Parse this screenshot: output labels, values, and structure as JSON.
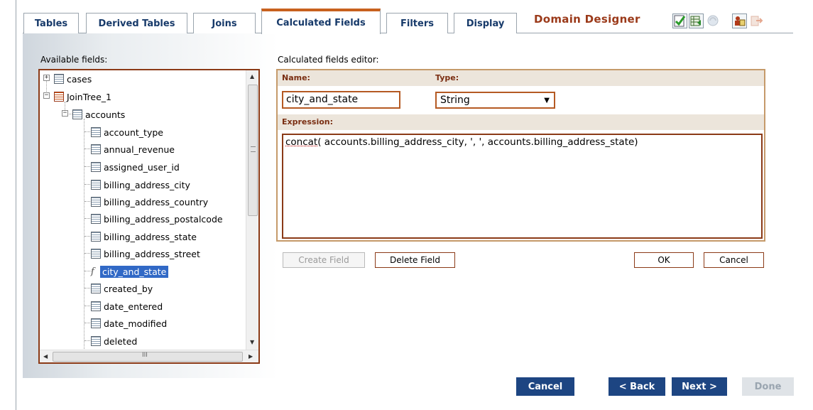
{
  "tabs": [
    {
      "label": "Tables"
    },
    {
      "label": "Derived Tables"
    },
    {
      "label": "Joins"
    },
    {
      "label": "Calculated Fields",
      "active": true
    },
    {
      "label": "Filters"
    },
    {
      "label": "Display"
    }
  ],
  "header": {
    "title": "Domain Designer",
    "toolbar_icons": [
      "check-document-icon",
      "table-export-icon",
      "refresh-globe-icon",
      "users-edit-icon",
      "exit-arrow-icon"
    ]
  },
  "available": {
    "label": "Available fields:",
    "tree": {
      "cases": "cases",
      "jointree": "JoinTree_1",
      "accounts": "accounts",
      "fields": [
        "account_type",
        "annual_revenue",
        "assigned_user_id",
        "billing_address_city",
        "billing_address_country",
        "billing_address_postalcode",
        "billing_address_state",
        "billing_address_street",
        "city_and_state",
        "created_by",
        "date_entered",
        "date_modified",
        "deleted"
      ],
      "selected": "city_and_state",
      "hscroll_mark": "III"
    }
  },
  "editor": {
    "label": "Calculated fields editor:",
    "name_label": "Name:",
    "type_label": "Type:",
    "name_value": "city_and_state",
    "type_value": "String",
    "expression_label": "Expression:",
    "expression_fn": "concat",
    "expression_rest": "( accounts.billing_address_city, ', ', accounts.billing_address_state)"
  },
  "buttons": {
    "create": "Create Field",
    "delete": "Delete Field",
    "ok": "OK",
    "cancel": "Cancel"
  },
  "nav": {
    "cancel": "Cancel",
    "back": "< Back",
    "next": "Next >",
    "done": "Done"
  },
  "colors": {
    "accent_tab": "#c8611e",
    "title": "#9b3a1a",
    "nav_button": "#1d4582",
    "selection": "#3169c6"
  }
}
